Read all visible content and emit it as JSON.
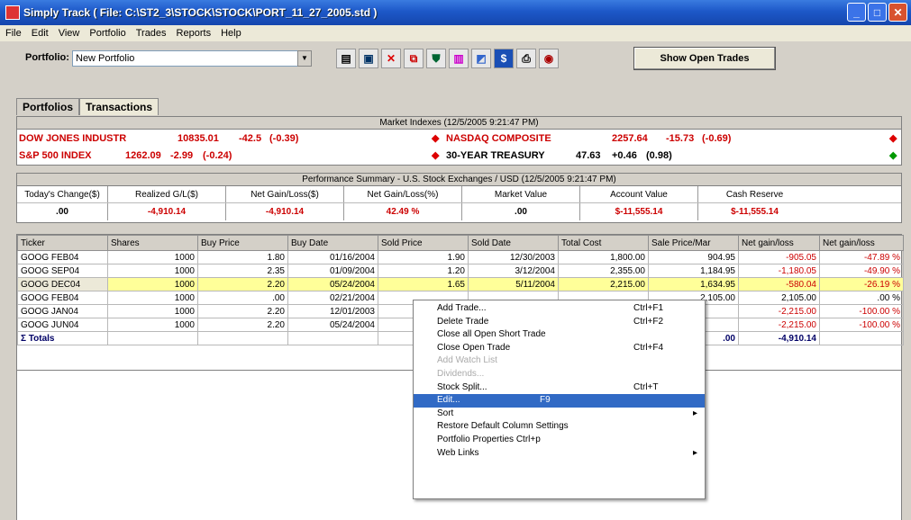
{
  "window": {
    "title": "Simply Track ( File: C:\\ST2_3\\STOCK\\STOCK\\PORT_11_27_2005.std )"
  },
  "menu": [
    "File",
    "Edit",
    "View",
    "Portfolio",
    "Trades",
    "Reports",
    "Help"
  ],
  "toolbar": {
    "portfolio_label": "Portfolio:",
    "portfolio_value": "New Portfolio",
    "show_open_trades": "Show Open Trades"
  },
  "tabs": [
    "Portfolios",
    "Transactions"
  ],
  "market": {
    "title": "Market Indexes (12/5/2005 9:21:47 PM)",
    "rows": [
      {
        "name": "DOW JONES INDUSTR",
        "value": "10835.01",
        "change": "-42.5",
        "pct": "(-0.39)"
      },
      {
        "name": "S&P 500 INDEX",
        "value": "1262.09",
        "change": "-2.99",
        "pct": "(-0.24)"
      },
      {
        "name": "NASDAQ COMPOSITE",
        "value": "2257.64",
        "change": "-15.73",
        "pct": "(-0.69)"
      },
      {
        "name": "30-YEAR TREASURY",
        "value": "47.63",
        "change": "+0.46",
        "pct": "(0.98)"
      }
    ]
  },
  "performance": {
    "title": "Performance Summary - U.S. Stock Exchanges / USD (12/5/2005 9:21:47 PM)",
    "headers": [
      "Today's Change($)",
      "Realized G/L($)",
      "Net Gain/Loss($)",
      "Net Gain/Loss(%)",
      "Market Value",
      "Account Value",
      "Cash Reserve"
    ],
    "values": [
      ".00",
      "-4,910.14",
      "-4,910.14",
      "42.49 %",
      ".00",
      "$-11,555.14",
      "$-11,555.14"
    ]
  },
  "grid": {
    "headers": [
      "Ticker",
      "Shares",
      "Buy Price",
      "Buy Date",
      "Sold Price",
      "Sold Date",
      "Total Cost",
      "Sale Price/Mar",
      "Net gain/loss",
      "Net gain/loss"
    ],
    "rows": [
      [
        "GOOG FEB04",
        "1000",
        "1.80",
        "01/16/2004",
        "1.90",
        "12/30/2003",
        "1,800.00",
        "904.95",
        "-905.05",
        "-47.89 %"
      ],
      [
        "GOOG SEP04",
        "1000",
        "2.35",
        "01/09/2004",
        "1.20",
        "3/12/2004",
        "2,355.00",
        "1,184.95",
        "-1,180.05",
        "-49.90 %"
      ],
      [
        "GOOG DEC04",
        "1000",
        "2.20",
        "05/24/2004",
        "1.65",
        "5/11/2004",
        "2,215.00",
        "1,634.95",
        "-580.04",
        "-26.19 %"
      ],
      [
        "GOOG FEB04",
        "1000",
        ".00",
        "02/21/2004",
        "",
        "",
        "",
        "2,105.00",
        "2,105.00",
        ".00 %"
      ],
      [
        "GOOG JAN04",
        "1000",
        "2.20",
        "12/01/2003",
        "",
        "",
        "",
        "",
        "-2,215.00",
        "-100.00 %"
      ],
      [
        "GOOG JUN04",
        "1000",
        "2.20",
        "05/24/2004",
        "",
        "",
        "",
        "",
        "-2,215.00",
        "-100.00 %"
      ],
      [
        "Σ Totals",
        "",
        "",
        "",
        "",
        "",
        "",
        ".00",
        "-4,910.14",
        ""
      ]
    ]
  },
  "context_menu": [
    {
      "label": "Add Trade...",
      "shortcut": "Ctrl+F1",
      "state": "normal"
    },
    {
      "label": "Delete Trade",
      "shortcut": "Ctrl+F2",
      "state": "normal"
    },
    {
      "label": "Close all Open Short Trade",
      "shortcut": "",
      "state": "normal"
    },
    {
      "label": "Close Open Trade",
      "shortcut": "Ctrl+F4",
      "state": "normal"
    },
    {
      "label": "Add Watch List",
      "shortcut": "",
      "state": "disabled"
    },
    {
      "label": "Dividends...",
      "shortcut": "",
      "state": "disabled"
    },
    {
      "label": "Stock Split...",
      "shortcut": "Ctrl+T",
      "state": "normal"
    },
    {
      "label": "Edit...",
      "shortcut": "F9",
      "state": "selected"
    },
    {
      "label": "Sort",
      "shortcut": "",
      "state": "submenu"
    },
    {
      "label": "Restore Default Column Settings",
      "shortcut": "",
      "state": "normal"
    },
    {
      "label": "Portfolio Properties   Ctrl+p",
      "shortcut": "",
      "state": "normal"
    },
    {
      "label": "Web Links",
      "shortcut": "",
      "state": "submenu"
    }
  ]
}
